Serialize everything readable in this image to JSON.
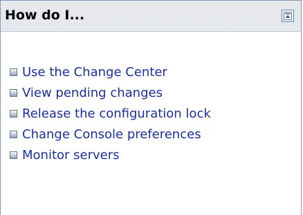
{
  "panel": {
    "title": "How do I...",
    "collapse_icon": "collapse-panel-icon"
  },
  "links": [
    {
      "label": "Use the Change Center"
    },
    {
      "label": "View pending changes"
    },
    {
      "label": "Release the configuration lock"
    },
    {
      "label": "Change Console preferences"
    },
    {
      "label": "Monitor servers"
    }
  ],
  "colors": {
    "link": "#1b2f9b",
    "header_bg": "#dfe3e8",
    "border": "#7f9db9"
  }
}
